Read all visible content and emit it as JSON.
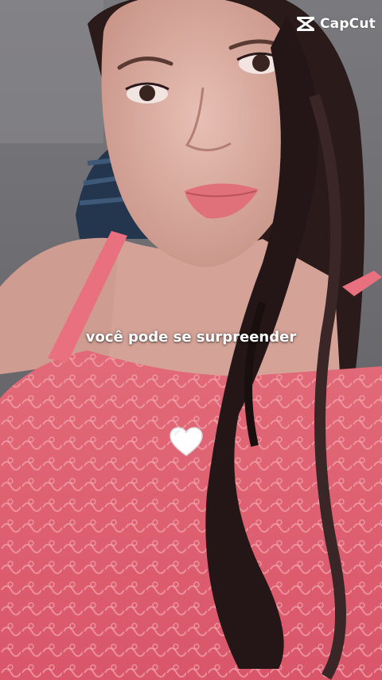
{
  "watermark": {
    "brand": "CapCut",
    "icon": "capcut-logo-icon"
  },
  "caption": {
    "text": "você pode se surpreender"
  },
  "sticker": {
    "icon": "white-heart-icon"
  },
  "colors": {
    "dress": "#e8707c",
    "skin": "#d6a49a",
    "hair": "#2a1a1a",
    "wall": "#6b6a6e"
  }
}
